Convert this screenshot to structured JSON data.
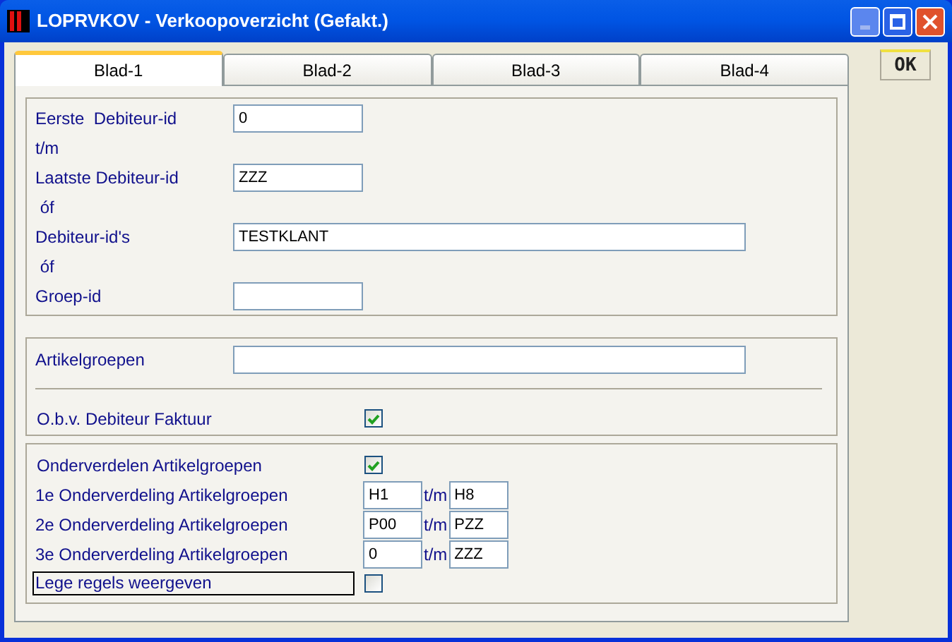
{
  "window": {
    "title": "LOPRVKOV - Verkoopoverzicht (Gefakt.)"
  },
  "tabs": [
    {
      "label": "Blad-1",
      "selected": true
    },
    {
      "label": "Blad-2",
      "selected": false
    },
    {
      "label": "Blad-3",
      "selected": false
    },
    {
      "label": "Blad-4",
      "selected": false
    }
  ],
  "ok_button": "OK",
  "section_1": [
    {
      "kind": "field",
      "label": "Eerste  Debiteur-id",
      "value": "0"
    },
    {
      "kind": "connector",
      "label": "t/m"
    },
    {
      "kind": "field",
      "label": "Laatste Debiteur-id",
      "value": "ZZZ"
    },
    {
      "kind": "connector",
      "label": " óf"
    },
    {
      "kind": "longfield",
      "label": "Debiteur-id's",
      "value": "TESTKLANT"
    },
    {
      "kind": "connector",
      "label": " óf"
    },
    {
      "kind": "field",
      "label": "Groep-id"
    }
  ],
  "section_2": [
    {
      "kind": "longfield",
      "label": "Artikelgroepen"
    },
    {
      "kind": "divider"
    },
    {
      "kind": "checkbox",
      "label": "O.b.v. Debiteur Faktuur",
      "checked": true,
      "focused": false
    }
  ],
  "section_3": [
    {
      "kind": "checkbox",
      "label": "Onderverdelen Artikelgroepen",
      "checked": true,
      "focused": false
    },
    {
      "kind": "range",
      "label": "1e Onderverdeling Artikelgroepen",
      "from": "H1",
      "separator": "t/m",
      "to": "H8"
    },
    {
      "kind": "range",
      "label": "2e Onderverdeling Artikelgroepen",
      "from": "P00",
      "separator": "t/m",
      "to": "PZZ"
    },
    {
      "kind": "range",
      "label": "3e Onderverdeling Artikelgroepen",
      "from": "0",
      "separator": "t/m",
      "to": "ZZZ"
    },
    {
      "kind": "checkbox",
      "label": "Lege regels weergeven",
      "checked": false,
      "focused": true
    }
  ]
}
